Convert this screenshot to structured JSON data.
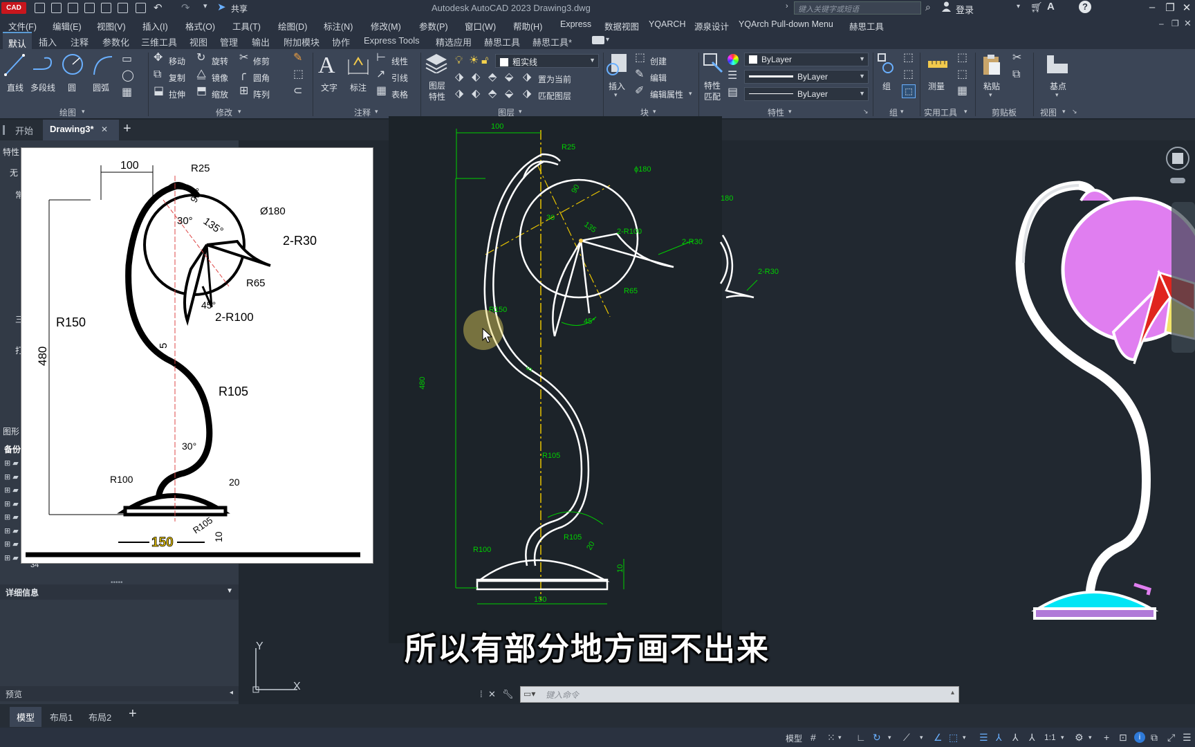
{
  "titlebar": {
    "logo": "CAD",
    "share": "共享",
    "title": "Autodesk AutoCAD 2023    Drawing3.dwg",
    "search_placeholder": "键入关键字或短语",
    "login": "登录"
  },
  "menu": [
    "文件(F)",
    "编辑(E)",
    "视图(V)",
    "插入(I)",
    "格式(O)",
    "工具(T)",
    "绘图(D)",
    "标注(N)",
    "修改(M)",
    "参数(P)",
    "窗口(W)",
    "帮助(H)",
    "Express",
    "数据视图",
    "YQARCH",
    "源泉设计",
    "YQArch Pull-down Menu",
    "赫思工具"
  ],
  "ribbon_tabs": [
    "默认",
    "插入",
    "注释",
    "参数化",
    "三维工具",
    "视图",
    "管理",
    "输出",
    "附加模块",
    "协作",
    "Express Tools",
    "精选应用",
    "赫思工具",
    "赫思工具*"
  ],
  "ribbon": {
    "draw": {
      "line": "直线",
      "polyline": "多段线",
      "circle": "圆",
      "arc": "圆弧",
      "panel": "绘图"
    },
    "modify": {
      "move": "移动",
      "rotate": "旋转",
      "trim": "修剪",
      "copy": "复制",
      "mirror": "镜像",
      "fillet": "圆角",
      "stretch": "拉伸",
      "scale": "缩放",
      "array": "阵列",
      "panel": "修改"
    },
    "annotation": {
      "text": "文字",
      "dimension": "标注",
      "linear": "线性",
      "leader": "引线",
      "table": "表格",
      "panel": "注释"
    },
    "layers": {
      "props": "图层特性",
      "current_layer": "粗实线",
      "set_current": "置为当前",
      "match": "匹配图层",
      "panel": "图层"
    },
    "block": {
      "insert": "插入",
      "create": "创建",
      "edit": "编辑",
      "edit_attr": "编辑属性",
      "panel": "块"
    },
    "properties": {
      "match": "特性匹配",
      "color": "ByLayer",
      "linetype": "ByLayer",
      "lineweight": "ByLayer",
      "panel": "特性"
    },
    "groups": {
      "group": "组",
      "panel": "组"
    },
    "utilities": {
      "measure": "测量",
      "panel": "实用工具"
    },
    "clipboard": {
      "paste": "粘贴",
      "panel": "剪贴板"
    },
    "view": {
      "base": "基点",
      "panel": "视图"
    }
  },
  "doc_tabs": {
    "start": "开始",
    "drawing": "Drawing3*"
  },
  "left_panel": {
    "header": "特性",
    "none": "无",
    "often": "常",
    "three": "三",
    "print": "打",
    "figure": "图形",
    "backup": "备份",
    "item34": "34",
    "details": "详细信息",
    "preview": "预览"
  },
  "ref_drawing": {
    "dims": {
      "d100": "100",
      "r25": "R25",
      "a90": "90°",
      "a30": "30°",
      "a135": "135°",
      "d180": "Ø180",
      "r30": "2-R30",
      "r65": "R65",
      "a45": "45°",
      "r100b": "2-R100",
      "r150": "R150",
      "d480": "480",
      "d5": "5",
      "r105": "R105",
      "a30b": "30°",
      "r100": "R100",
      "d20": "20",
      "r105b": "R105",
      "d10": "10",
      "d150": "150"
    }
  },
  "cad_drawing": {
    "dims": {
      "d100": "100",
      "r25": "R25",
      "d180": "ϕ180",
      "a90": "90",
      "a30": "30",
      "a135": "135",
      "r30": "2-R30",
      "r100b": "2-R100",
      "r65": "R65",
      "a45": "45°",
      "r150": "R150",
      "d480": "480",
      "d5": "5",
      "r105": "R105",
      "r100": "R100",
      "r105b": "R105",
      "d20": "20",
      "d10": "10",
      "d150": "150",
      "r180": "180",
      "r30b": "2-R30"
    }
  },
  "subtitle": "所以有部分地方画不出来",
  "command": {
    "placeholder": "键入命令"
  },
  "axis": {
    "y": "Y",
    "x": "X"
  },
  "layout_tabs": [
    "模型",
    "布局1",
    "布局2"
  ],
  "status": {
    "model": "模型",
    "scale": "1:1"
  },
  "colors": {
    "shade": "#e07ef0",
    "base": "#00e5f5",
    "accent_red": "#e0251e",
    "accent_yellow": "#f2e46a",
    "dim": "#00d000",
    "center": "#e6c200"
  }
}
